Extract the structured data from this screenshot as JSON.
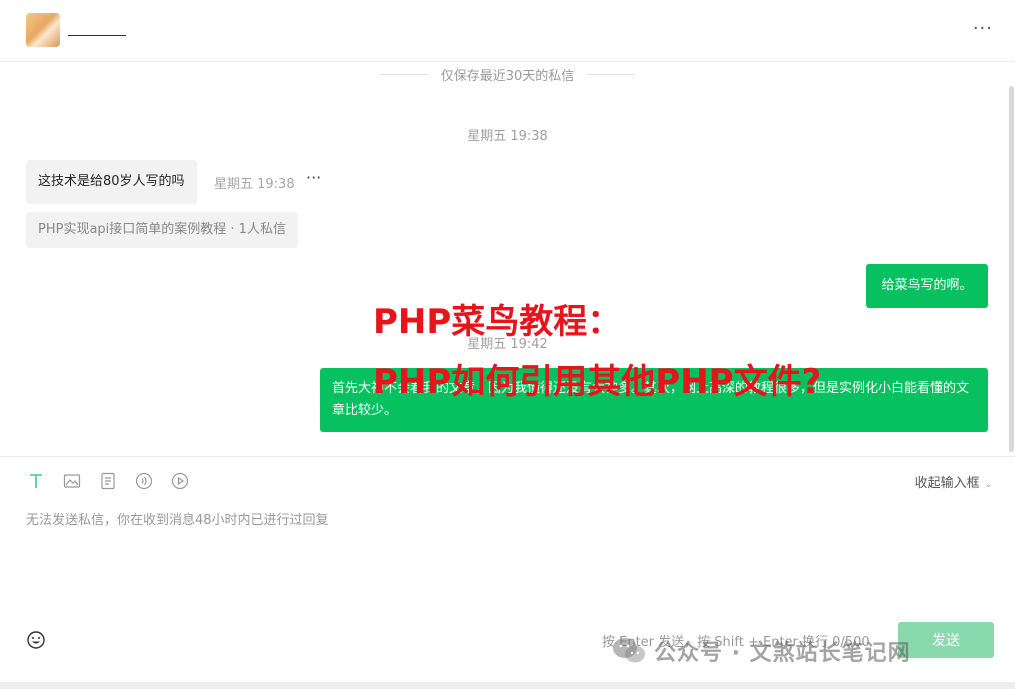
{
  "header": {
    "contact_name": "",
    "more_label": "···"
  },
  "chat": {
    "retention_notice": "仅保存最近30天的私信",
    "time_divider_1": "星期五 19:38",
    "time_divider_2": "星期五 19:42",
    "messages": [
      {
        "side": "incoming",
        "text": "这技术是给80岁人写的吗",
        "time": "星期五 19:38"
      },
      {
        "side": "outgoing",
        "text": "给菜鸟写的啊。"
      },
      {
        "side": "outgoing",
        "text": "首先大神不会看我的文章，因为我懂得还没有大神多。其次，网上高深的教程很多，但是实例化小白能看懂的文章比较少。"
      }
    ],
    "message_more_label": "···",
    "reference_card": "PHP实现api接口简单的案例教程 · 1人私信"
  },
  "overlay": {
    "title_line1": "PHP菜鸟教程：",
    "title_line2": "PHP如何引用其他PHP文件?",
    "color": "#e8141b"
  },
  "input": {
    "toolbar_icons": [
      "text-icon",
      "image-icon",
      "document-icon",
      "voice-icon",
      "video-icon"
    ],
    "collapse_label": "收起输入框",
    "disabled_notice": "无法发送私信，你在收到消息48小时内已进行过回复",
    "hint": "按 Enter 发送，按 Shift + Enter 换行  0/500",
    "send_label": "发送"
  },
  "watermark": {
    "text": "公众号 · 文煞站长笔记网"
  },
  "colors": {
    "accent": "#07c160",
    "send_disabled": "#8ad9ae",
    "bubble_incoming": "#f2f2f2"
  }
}
